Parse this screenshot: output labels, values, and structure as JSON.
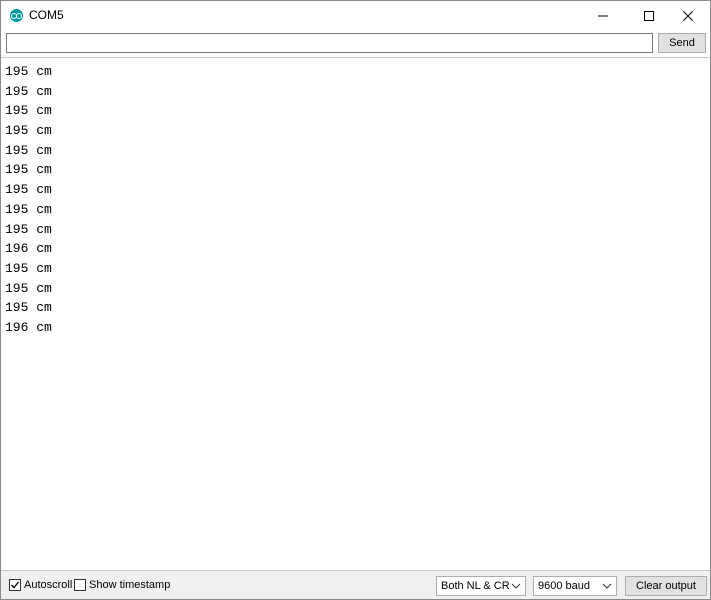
{
  "window": {
    "title": "COM5",
    "icon": "arduino-icon",
    "controls": [
      "minimize-icon",
      "maximize-icon",
      "close-icon"
    ]
  },
  "send_bar": {
    "input_value": "",
    "input_placeholder": "",
    "send_label": "Send"
  },
  "output": {
    "lines": [
      "195 cm",
      "195 cm",
      "195 cm",
      "195 cm",
      "195 cm",
      "195 cm",
      "195 cm",
      "195 cm",
      "195 cm",
      "196 cm",
      "195 cm",
      "195 cm",
      "195 cm",
      "196 cm"
    ]
  },
  "bottom_bar": {
    "autoscroll_label": "Autoscroll",
    "autoscroll_checked": true,
    "timestamp_label": "Show timestamp",
    "timestamp_checked": false,
    "line_ending": "Both NL & CR",
    "baud_rate": "9600 baud",
    "clear_label": "Clear output"
  },
  "colors": {
    "icon_teal": "#00979d",
    "chrome_bg": "#f0f0f0",
    "button_bg": "#e1e1e1"
  }
}
